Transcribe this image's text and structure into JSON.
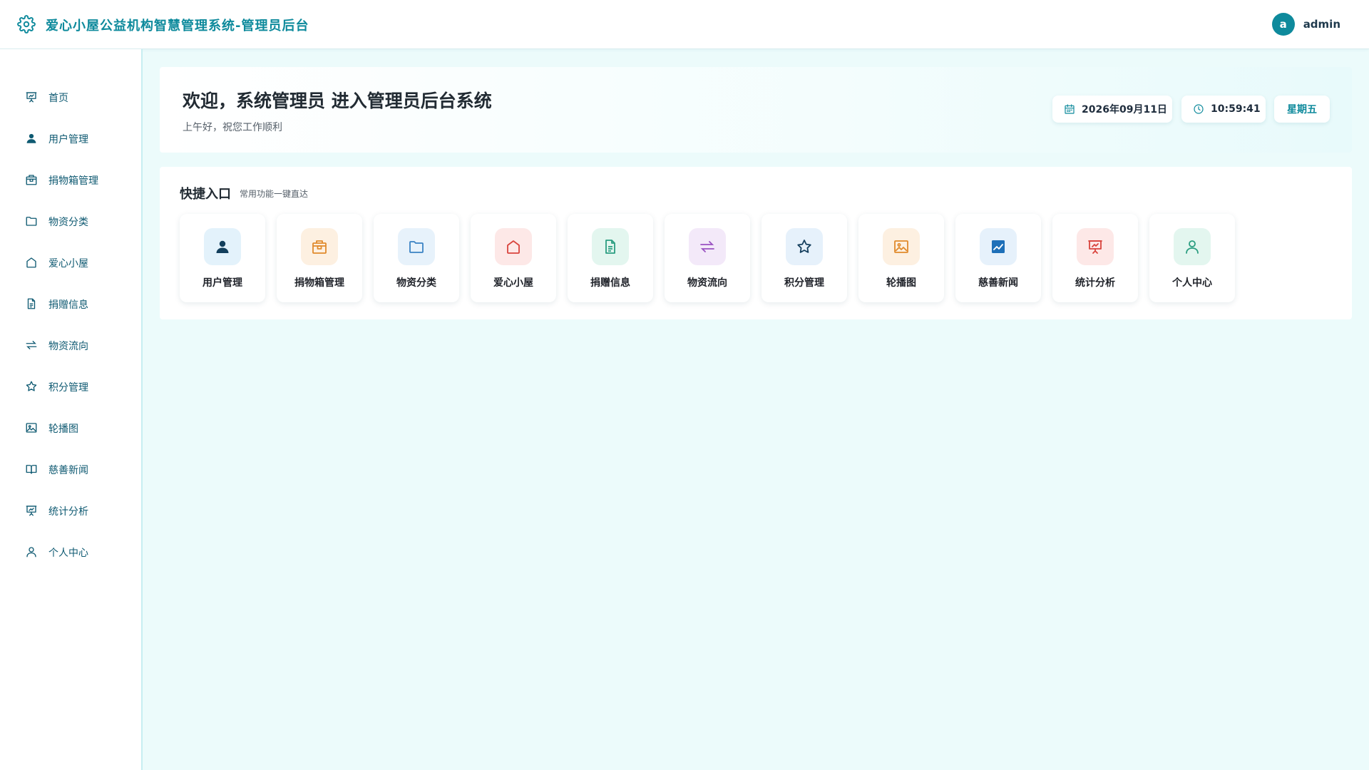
{
  "header": {
    "logo_icon": "gear-icon",
    "app_title": "爱心小屋公益机构智慧管理系统-管理员后台",
    "avatar_letter": "a",
    "username": "admin",
    "accent_color": "#0e8a9c"
  },
  "sidebar": {
    "items": [
      {
        "label": "首页",
        "icon": "presentation-icon"
      },
      {
        "label": "用户管理",
        "icon": "user-icon"
      },
      {
        "label": "捐物箱管理",
        "icon": "box-icon"
      },
      {
        "label": "物资分类",
        "icon": "folder-icon"
      },
      {
        "label": "爱心小屋",
        "icon": "home-icon"
      },
      {
        "label": "捐赠信息",
        "icon": "document-icon"
      },
      {
        "label": "物资流向",
        "icon": "transfer-icon"
      },
      {
        "label": "积分管理",
        "icon": "star-icon"
      },
      {
        "label": "轮播图",
        "icon": "image-icon"
      },
      {
        "label": "慈善新闻",
        "icon": "book-icon"
      },
      {
        "label": "统计分析",
        "icon": "presentation-icon"
      },
      {
        "label": "个人中心",
        "icon": "user-outline-icon"
      }
    ]
  },
  "welcome": {
    "title": "欢迎，系统管理员 进入管理员后台系统",
    "subtitle": "上午好，祝您工作顺利",
    "date": "2026年09月11日",
    "time": "10:59:41",
    "weekday": "星期五"
  },
  "quick": {
    "title": "快捷入口",
    "subtitle": "常用功能一键直达",
    "tiles": [
      {
        "label": "用户管理",
        "icon": "user-icon",
        "color": "#123f5c",
        "bg": "#e3f2fb"
      },
      {
        "label": "捐物箱管理",
        "icon": "box-icon",
        "color": "#e08a2c",
        "bg": "#fdf0e1"
      },
      {
        "label": "物资分类",
        "icon": "folder-icon",
        "color": "#3a82c4",
        "bg": "#e7f2fb"
      },
      {
        "label": "爱心小屋",
        "icon": "home-icon",
        "color": "#d9443d",
        "bg": "#fde8e7"
      },
      {
        "label": "捐赠信息",
        "icon": "document-icon",
        "color": "#2a9d80",
        "bg": "#e3f6ef"
      },
      {
        "label": "物资流向",
        "icon": "transfer-icon",
        "color": "#9a52c2",
        "bg": "#f3e9f9"
      },
      {
        "label": "积分管理",
        "icon": "star-icon",
        "color": "#16405e",
        "bg": "#e6f1fb"
      },
      {
        "label": "轮播图",
        "icon": "image-icon",
        "color": "#e08a2c",
        "bg": "#fdf0e1"
      },
      {
        "label": "慈善新闻",
        "icon": "chart-icon",
        "color": "#1d6fb8",
        "bg": "#e6f1fb"
      },
      {
        "label": "统计分析",
        "icon": "presentation-icon",
        "color": "#d9443d",
        "bg": "#fde8e7"
      },
      {
        "label": "个人中心",
        "icon": "user-outline-icon",
        "color": "#2a9d80",
        "bg": "#e3f6ef"
      }
    ]
  }
}
